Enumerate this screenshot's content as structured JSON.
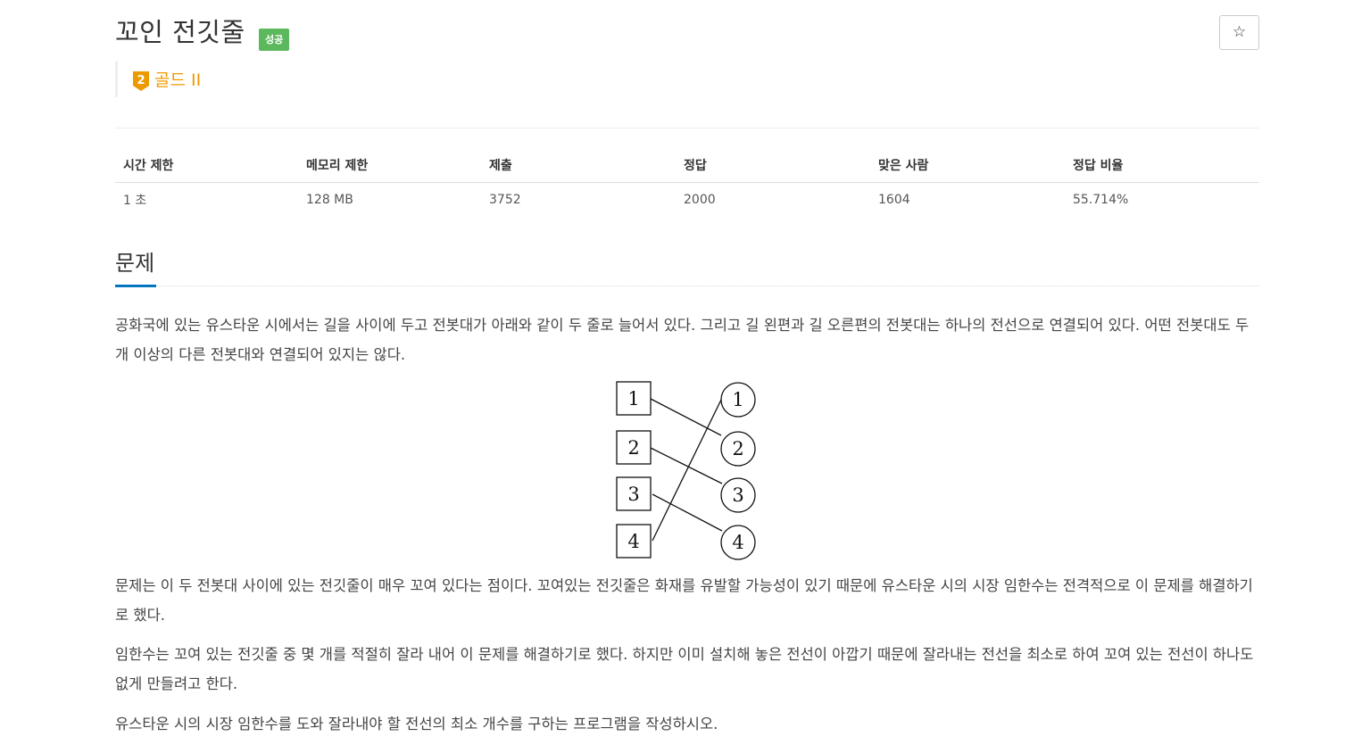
{
  "problem": {
    "title": "꼬인 전깃줄",
    "status_badge": "성공",
    "star_icon": "star-outline-icon",
    "tier": {
      "number": "2",
      "label": "골드 II",
      "color": "#ec9a00"
    }
  },
  "info_table": {
    "headers": [
      "시간 제한",
      "메모리 제한",
      "제출",
      "정답",
      "맞은 사람",
      "정답 비율"
    ],
    "values": [
      "1 초",
      "128 MB",
      "3752",
      "2000",
      "1604",
      "55.714%"
    ]
  },
  "section": {
    "title": "문제"
  },
  "paragraphs": [
    "공화국에 있는 유스타운 시에서는 길을 사이에 두고 전봇대가 아래와 같이 두 줄로 늘어서 있다. 그리고 길 왼편과 길 오른편의 전봇대는 하나의 전선으로 연결되어 있다. 어떤 전봇대도 두 개 이상의 다른 전봇대와 연결되어 있지는 않다.",
    "문제는 이 두 전봇대 사이에 있는 전깃줄이 매우 꼬여 있다는 점이다. 꼬여있는 전깃줄은 화재를 유발할 가능성이 있기 때문에 유스타운 시의 시장 임한수는 전격적으로 이 문제를 해결하기로 했다.",
    "임한수는 꼬여 있는 전깃줄 중 몇 개를 적절히 잘라 내어 이 문제를 해결하기로 했다. 하지만 이미 설치해 놓은 전선이 아깝기 때문에 잘라내는 전선을 최소로 하여 꼬여 있는 전선이 하나도 없게 만들려고 한다.",
    "유스타운 시의 시장 임한수를 도와 잘라내야 할 전선의 최소 개수를 구하는 프로그램을 작성하시오."
  ],
  "figure": {
    "left_poles": [
      "1",
      "2",
      "3",
      "4"
    ],
    "right_poles": [
      "1",
      "2",
      "3",
      "4"
    ],
    "connections": [
      [
        1,
        2
      ],
      [
        2,
        3
      ],
      [
        3,
        4
      ],
      [
        4,
        1
      ]
    ]
  },
  "colors": {
    "badge": "#5cb85c",
    "accent": "#0076c0",
    "tier": "#ec9a00"
  }
}
